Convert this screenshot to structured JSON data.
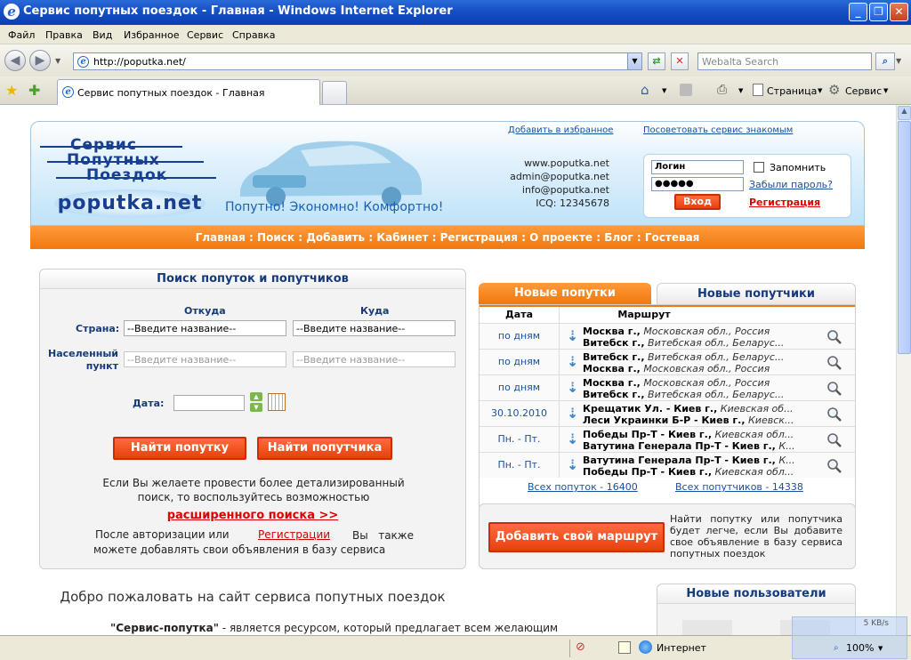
{
  "window": {
    "title": "Сервис попутных поездок - Главная - Windows Internet Explorer"
  },
  "menu": [
    "Файл",
    "Правка",
    "Вид",
    "Избранное",
    "Сервис",
    "Справка"
  ],
  "address": {
    "url": "http://poputka.net/"
  },
  "search": {
    "placeholder": "Webalta Search"
  },
  "tab": {
    "title": "Сервис попутных поездок - Главная"
  },
  "commandbar": {
    "page": "Страница",
    "tools": "Сервис"
  },
  "status": {
    "zone": "Интернет",
    "zoom": "100%",
    "speed": "5 KB/s"
  },
  "site": {
    "logo_lines": [
      "Сервис",
      "Попутных",
      "Поездок"
    ],
    "logo_domain": "poputka.net",
    "slogan": "Попутно! Экономно! Комфортно!",
    "links": {
      "favorites": "Добавить в избранное",
      "recommend": "Посоветовать сервис знакомым"
    },
    "contacts": [
      "www.poputka.net",
      "admin@poputka.net",
      "info@poputka.net",
      "ICQ: 12345678"
    ],
    "login": {
      "login_value": "Логин",
      "password_value": "●●●●●",
      "remember": "Запомнить",
      "forgot": "Забыли пароль?",
      "enter": "Вход",
      "register": "Регистрация"
    },
    "nav": [
      "Главная",
      ":",
      "Поиск",
      ":",
      "Добавить",
      ":",
      "Кабинет",
      ":",
      "Регистрация",
      ":",
      "О проекте",
      ":",
      "Блог",
      ":",
      "Гостевая"
    ]
  },
  "search_panel": {
    "title": "Поиск попуток и попутчиков",
    "from": "Откуда",
    "to": "Куда",
    "country": "Страна:",
    "locality": "Населенный пункт",
    "placeholder": "--Введите название--",
    "date": "Дата:",
    "find_ride": "Найти попутку",
    "find_companion": "Найти попутчика",
    "info1": "Если Вы желаете провести более детализированный поиск, то воспользуйтесь возможностью",
    "advanced": "расширенного поиска >>",
    "info2a": "После авторизации или",
    "info2link": "Регистрации",
    "info2b": "Вы также можете добавлять свои объявления в базу сервиса"
  },
  "rides": {
    "tab_active": "Новые попутки",
    "tab_inactive": "Новые попутчики",
    "col_date": "Дата",
    "col_route": "Маршрут",
    "rows": [
      {
        "date": "по дням",
        "from_city": "Москва г.,",
        "from_region": "Московская обл., Россия",
        "to_city": "Витебск г.,",
        "to_region": "Витебская обл., Беларус..."
      },
      {
        "date": "по дням",
        "from_city": "Витебск г.,",
        "from_region": "Витебская обл., Беларус...",
        "to_city": "Москва г.,",
        "to_region": "Московская обл., Россия"
      },
      {
        "date": "по дням",
        "from_city": "Москва г.,",
        "from_region": "Московская обл., Россия",
        "to_city": "Витебск г.,",
        "to_region": "Витебская обл., Беларус..."
      },
      {
        "date": "30.10.2010",
        "from_city": "Крещатик Ул. - Киев г.,",
        "from_region": "Киевская об...",
        "to_city": "Леси Украинки Б-Р - Киев г.,",
        "to_region": "Киевск..."
      },
      {
        "date": "Пн. - Пт.",
        "from_city": "Победы Пр-Т - Киев г.,",
        "from_region": "Киевская обл...",
        "to_city": "Ватутина Генерала Пр-Т - Киев г.,",
        "to_region": "К..."
      },
      {
        "date": "Пн. - Пт.",
        "from_city": "Ватутина Генерала Пр-Т - Киев г.,",
        "from_region": "К...",
        "to_city": "Победы Пр-Т - Киев г.,",
        "to_region": "Киевская обл..."
      }
    ],
    "all_rides": "Всех попуток - 16400",
    "all_companions": "Всех попутчиков - 14338"
  },
  "add_route": {
    "button": "Добавить свой маршрут",
    "text": "Найти попутку или попутчика будет легче, если Вы добавите свое объявление в базу сервиса попутных поездок"
  },
  "welcome": {
    "title": "Добро пожаловать на сайт сервиса попутных поездок",
    "lead_bold": "\"Сервис-попутка\"",
    "lead_text": " - является ресурсом, который предлагает всем желающим"
  },
  "new_users": {
    "title": "Новые пользователи"
  },
  "colors": {
    "accent_orange": "#f07810",
    "nav_blue": "#163a7a",
    "link_blue": "#1a4f9c",
    "red_button": "#e8400f"
  }
}
